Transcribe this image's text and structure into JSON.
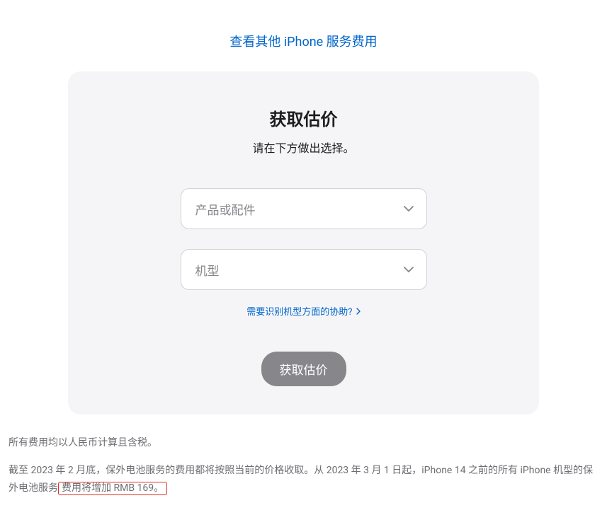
{
  "topLink": {
    "label": "查看其他 iPhone 服务费用"
  },
  "card": {
    "title": "获取估价",
    "subtitle": "请在下方做出选择。",
    "select1": {
      "placeholder": "产品或配件"
    },
    "select2": {
      "placeholder": "机型"
    },
    "helpLink": {
      "label": "需要识别机型方面的协助?"
    },
    "submitButton": {
      "label": "获取估价"
    }
  },
  "footer": {
    "line1": "所有费用均以人民币计算且含税。",
    "line2_pre": "截至 2023 年 2 月底，保外电池服务的费用都将按照当前的价格收取。从 2023 年 3 月 1 日起，iPhone 14 之前的所有 iPhone 机型的保外电池服务",
    "line2_highlight": "费用将增加 RMB 169。"
  }
}
